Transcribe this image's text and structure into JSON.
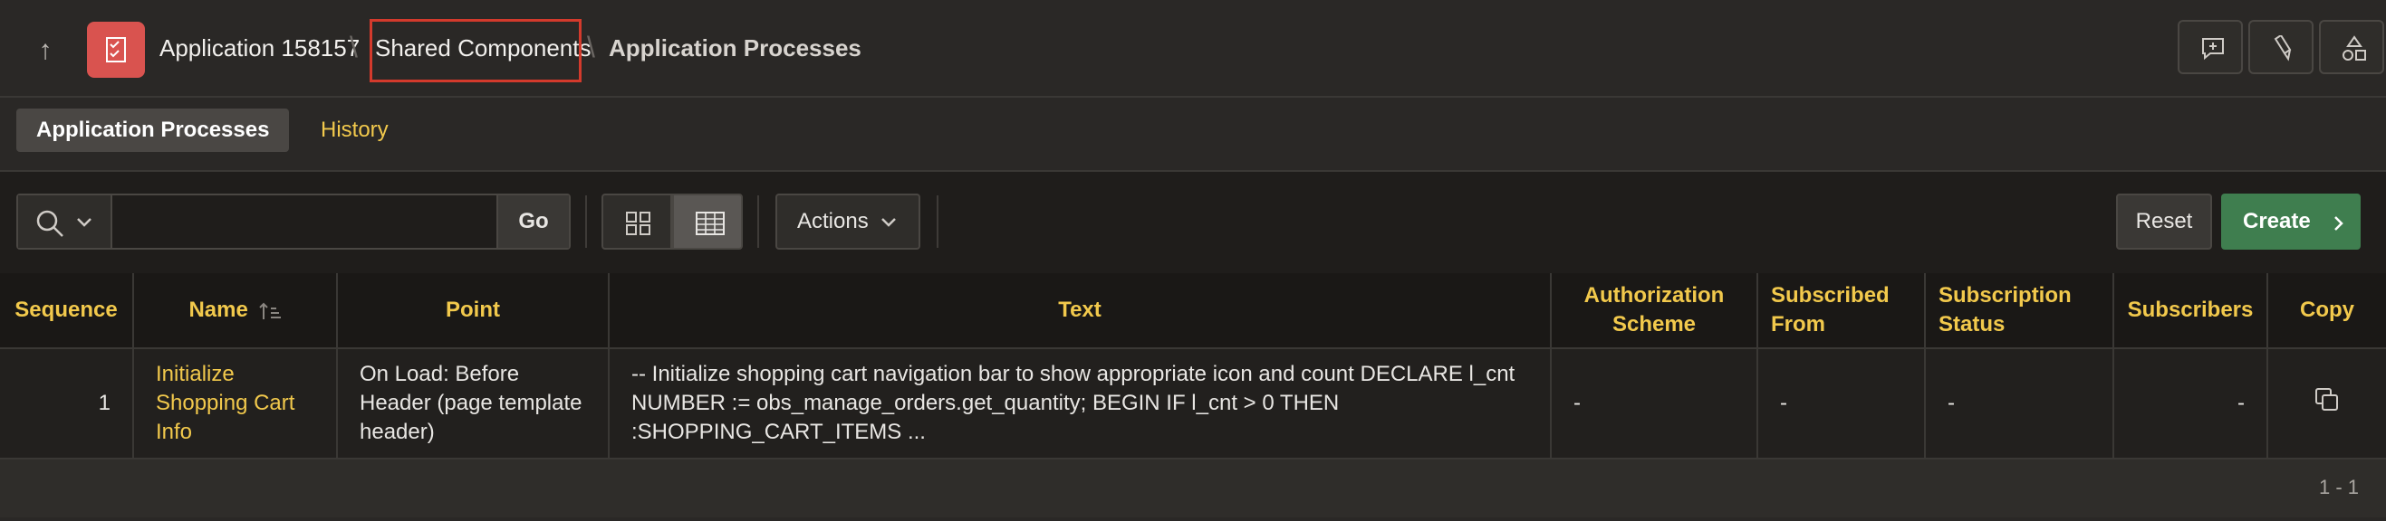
{
  "breadcrumb": {
    "app": "Application 158157",
    "shared": "Shared Components",
    "current": "Application Processes"
  },
  "tabs": [
    {
      "label": "Application Processes"
    },
    {
      "label": "History"
    }
  ],
  "toolbar": {
    "go_label": "Go",
    "actions_label": "Actions",
    "reset_label": "Reset",
    "create_label": "Create",
    "search_value": ""
  },
  "table": {
    "columns": [
      "Sequence",
      "Name",
      "Point",
      "Text",
      "Authorization Scheme",
      "Subscribed From",
      "Subscription Status",
      "Subscribers",
      "Copy"
    ],
    "rows": [
      {
        "sequence": "1",
        "name": "Initialize Shopping Cart Info",
        "point": "On Load: Before Header (page template header)",
        "text": "-- Initialize shopping cart navigation bar to show appropriate icon and count DECLARE l_cnt NUMBER := obs_manage_orders.get_quantity; BEGIN IF l_cnt > 0 THEN :SHOPPING_CART_ITEMS ...",
        "auth": "-",
        "subscribed_from": "-",
        "subscription_status": "-",
        "subscribers": "-"
      }
    ]
  },
  "pagination": "1 - 1",
  "colors": {
    "accent": "#f2c94c",
    "create": "#3f7e4f",
    "app_icon": "#d9534f",
    "highlight": "#d33a2c"
  }
}
